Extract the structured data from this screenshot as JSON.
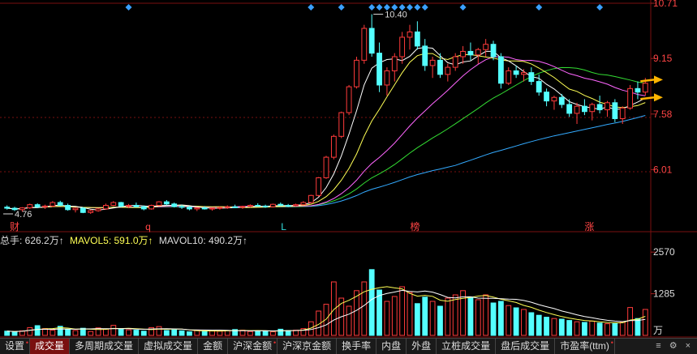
{
  "price_axis_labels": [
    "10.71",
    "9.15",
    "7.58",
    "6.01"
  ],
  "price_range": [
    4.44,
    10.71
  ],
  "annotations": {
    "high": "10.40",
    "high_value": 10.4,
    "low": "4.76",
    "low_value": 4.76
  },
  "event_markers": [
    {
      "label": "财",
      "pos": 0.01
    },
    {
      "label": "q",
      "pos": 0.22
    },
    {
      "label": "L",
      "pos": 0.43
    },
    {
      "label": "榜",
      "pos": 0.63
    },
    {
      "label": "涨",
      "pos": 0.9
    }
  ],
  "volume_axis_labels": [
    "2570",
    "1285"
  ],
  "volume_unit": "万",
  "volume_range": [
    0,
    2700
  ],
  "volume_legend": {
    "total": "总手: 626.2万↑",
    "ma5": "MAVOL5: 591.0万↑",
    "ma10": "MAVOL10: 490.2万↑"
  },
  "colors": {
    "up": "#ff3b3b",
    "down": "#54ffff",
    "ma5": "#ffffff",
    "ma10": "#ffff55",
    "ma20": "#ff66ff",
    "ma30": "#33dd33",
    "ma60": "#33aaff",
    "arrow": "#ffb400",
    "grid": "#7a1010",
    "diamond": "#3aa0ff"
  },
  "tabs": [
    {
      "label": "设置",
      "marked": true
    },
    {
      "label": "成交量",
      "active": true
    },
    {
      "label": "多周期成交量"
    },
    {
      "label": "虚拟成交量"
    },
    {
      "label": "金额"
    },
    {
      "label": "沪深金额",
      "marked": true
    },
    {
      "label": "沪深京金额"
    },
    {
      "label": "换手率"
    },
    {
      "label": "内盘"
    },
    {
      "label": "外盘"
    },
    {
      "label": "立桩成交量"
    },
    {
      "label": "盘后成交量"
    },
    {
      "label": "市盈率(ttm)",
      "marked": true
    }
  ],
  "tab_end_icons": [
    "menu-icon",
    "gear-icon",
    "close-icon"
  ],
  "chart_data": {
    "type": "candlestick",
    "candles": [
      [
        4.95,
        5.0,
        4.88,
        4.92
      ],
      [
        4.92,
        4.96,
        4.84,
        4.88
      ],
      [
        4.88,
        4.95,
        4.82,
        4.93
      ],
      [
        4.93,
        5.05,
        4.9,
        5.02
      ],
      [
        5.02,
        5.06,
        4.92,
        4.96
      ],
      [
        4.96,
        5.02,
        4.9,
        4.98
      ],
      [
        4.98,
        5.12,
        4.95,
        5.08
      ],
      [
        5.08,
        5.13,
        4.98,
        5.0
      ],
      [
        5.0,
        5.05,
        4.85,
        4.88
      ],
      [
        4.88,
        4.94,
        4.8,
        4.92
      ],
      [
        4.92,
        4.95,
        4.78,
        4.8
      ],
      [
        4.8,
        4.88,
        4.76,
        4.85
      ],
      [
        4.85,
        4.92,
        4.82,
        4.9
      ],
      [
        4.9,
        5.05,
        4.88,
        5.0
      ],
      [
        5.0,
        5.12,
        4.98,
        5.08
      ],
      [
        5.08,
        5.1,
        4.95,
        4.98
      ],
      [
        4.98,
        5.04,
        4.92,
        5.0
      ],
      [
        5.0,
        5.08,
        4.95,
        4.96
      ],
      [
        4.96,
        5.0,
        4.86,
        4.9
      ],
      [
        4.9,
        5.02,
        4.88,
        5.0
      ],
      [
        5.0,
        5.12,
        4.98,
        5.1
      ],
      [
        5.1,
        5.15,
        5.0,
        5.04
      ],
      [
        5.04,
        5.08,
        4.94,
        4.97
      ],
      [
        4.97,
        5.02,
        4.9,
        4.95
      ],
      [
        4.95,
        4.98,
        4.86,
        4.9
      ],
      [
        4.9,
        4.95,
        4.84,
        4.93
      ],
      [
        4.93,
        4.98,
        4.88,
        4.9
      ],
      [
        4.9,
        4.94,
        4.85,
        4.92
      ],
      [
        4.92,
        4.97,
        4.88,
        4.94
      ],
      [
        4.94,
        5.0,
        4.9,
        4.96
      ],
      [
        4.96,
        5.02,
        4.92,
        4.95
      ],
      [
        4.95,
        4.99,
        4.9,
        4.97
      ],
      [
        4.97,
        5.03,
        4.94,
        5.0
      ],
      [
        5.0,
        5.06,
        4.96,
        4.98
      ],
      [
        4.98,
        5.02,
        4.93,
        4.96
      ],
      [
        4.96,
        5.05,
        4.94,
        5.03
      ],
      [
        5.03,
        5.08,
        4.98,
        5.0
      ],
      [
        5.0,
        5.04,
        4.95,
        4.99
      ],
      [
        4.99,
        5.05,
        4.96,
        5.02
      ],
      [
        5.02,
        5.12,
        5.0,
        5.08
      ],
      [
        5.08,
        5.3,
        5.05,
        5.28
      ],
      [
        5.28,
        5.8,
        5.25,
        5.78
      ],
      [
        5.78,
        6.4,
        5.75,
        6.36
      ],
      [
        6.36,
        7.0,
        6.3,
        6.95
      ],
      [
        6.95,
        7.65,
        6.9,
        7.62
      ],
      [
        7.62,
        8.4,
        7.55,
        8.35
      ],
      [
        8.35,
        9.2,
        8.3,
        9.1
      ],
      [
        9.1,
        10.1,
        9.0,
        10.0
      ],
      [
        10.0,
        10.4,
        9.2,
        9.3
      ],
      [
        9.3,
        9.6,
        8.2,
        8.4
      ],
      [
        8.4,
        8.9,
        8.1,
        8.8
      ],
      [
        8.8,
        9.3,
        8.5,
        9.2
      ],
      [
        9.2,
        9.9,
        9.0,
        9.75
      ],
      [
        9.75,
        10.1,
        9.4,
        9.9
      ],
      [
        9.9,
        10.2,
        9.4,
        9.5
      ],
      [
        9.5,
        9.7,
        8.8,
        8.95
      ],
      [
        8.95,
        9.2,
        8.6,
        9.1
      ],
      [
        9.1,
        9.3,
        8.6,
        8.7
      ],
      [
        8.7,
        9.0,
        8.5,
        8.9
      ],
      [
        8.9,
        9.3,
        8.8,
        9.2
      ],
      [
        9.2,
        9.5,
        9.0,
        9.35
      ],
      [
        9.35,
        9.6,
        9.1,
        9.25
      ],
      [
        9.25,
        9.45,
        9.0,
        9.4
      ],
      [
        9.4,
        9.7,
        9.2,
        9.55
      ],
      [
        9.55,
        9.65,
        9.1,
        9.2
      ],
      [
        9.2,
        9.3,
        8.3,
        8.45
      ],
      [
        8.45,
        8.9,
        8.4,
        8.8
      ],
      [
        8.8,
        8.95,
        8.6,
        8.7
      ],
      [
        8.7,
        8.85,
        8.5,
        8.75
      ],
      [
        8.75,
        8.9,
        8.4,
        8.5
      ],
      [
        8.5,
        8.7,
        8.1,
        8.2
      ],
      [
        8.2,
        8.3,
        7.8,
        7.95
      ],
      [
        7.95,
        8.1,
        7.7,
        8.05
      ],
      [
        8.05,
        8.15,
        7.75,
        7.85
      ],
      [
        7.85,
        8.0,
        7.5,
        7.6
      ],
      [
        7.6,
        7.9,
        7.3,
        7.8
      ],
      [
        7.8,
        8.0,
        7.55,
        7.65
      ],
      [
        7.65,
        7.9,
        7.4,
        7.85
      ],
      [
        7.85,
        8.1,
        7.6,
        7.7
      ],
      [
        7.7,
        7.95,
        7.5,
        7.9
      ],
      [
        7.9,
        8.0,
        7.35,
        7.45
      ],
      [
        7.45,
        7.8,
        7.3,
        7.75
      ],
      [
        7.75,
        8.4,
        7.7,
        8.3
      ],
      [
        8.3,
        8.5,
        8.0,
        8.2
      ],
      [
        8.2,
        8.6,
        8.1,
        8.45
      ]
    ],
    "volume": [
      130,
      110,
      140,
      240,
      300,
      210,
      160,
      280,
      180,
      150,
      220,
      120,
      230,
      200,
      310,
      190,
      170,
      160,
      130,
      240,
      270,
      150,
      170,
      140,
      110,
      160,
      120,
      140,
      130,
      150,
      180,
      160,
      120,
      140,
      130,
      110,
      190,
      150,
      160,
      210,
      420,
      750,
      960,
      1650,
      1150,
      900,
      1380,
      1650,
      2030,
      1400,
      1050,
      1200,
      1500,
      1320,
      980,
      1180,
      1050,
      900,
      1150,
      1250,
      1380,
      1180,
      1100,
      1250,
      1000,
      1050,
      920,
      850,
      800,
      700,
      620,
      560,
      520,
      500,
      460,
      420,
      400,
      440,
      380,
      360,
      360,
      400,
      860,
      520,
      800
    ],
    "series": [
      {
        "name": "MAVOL5"
      },
      {
        "name": "MAVOL10"
      }
    ]
  }
}
